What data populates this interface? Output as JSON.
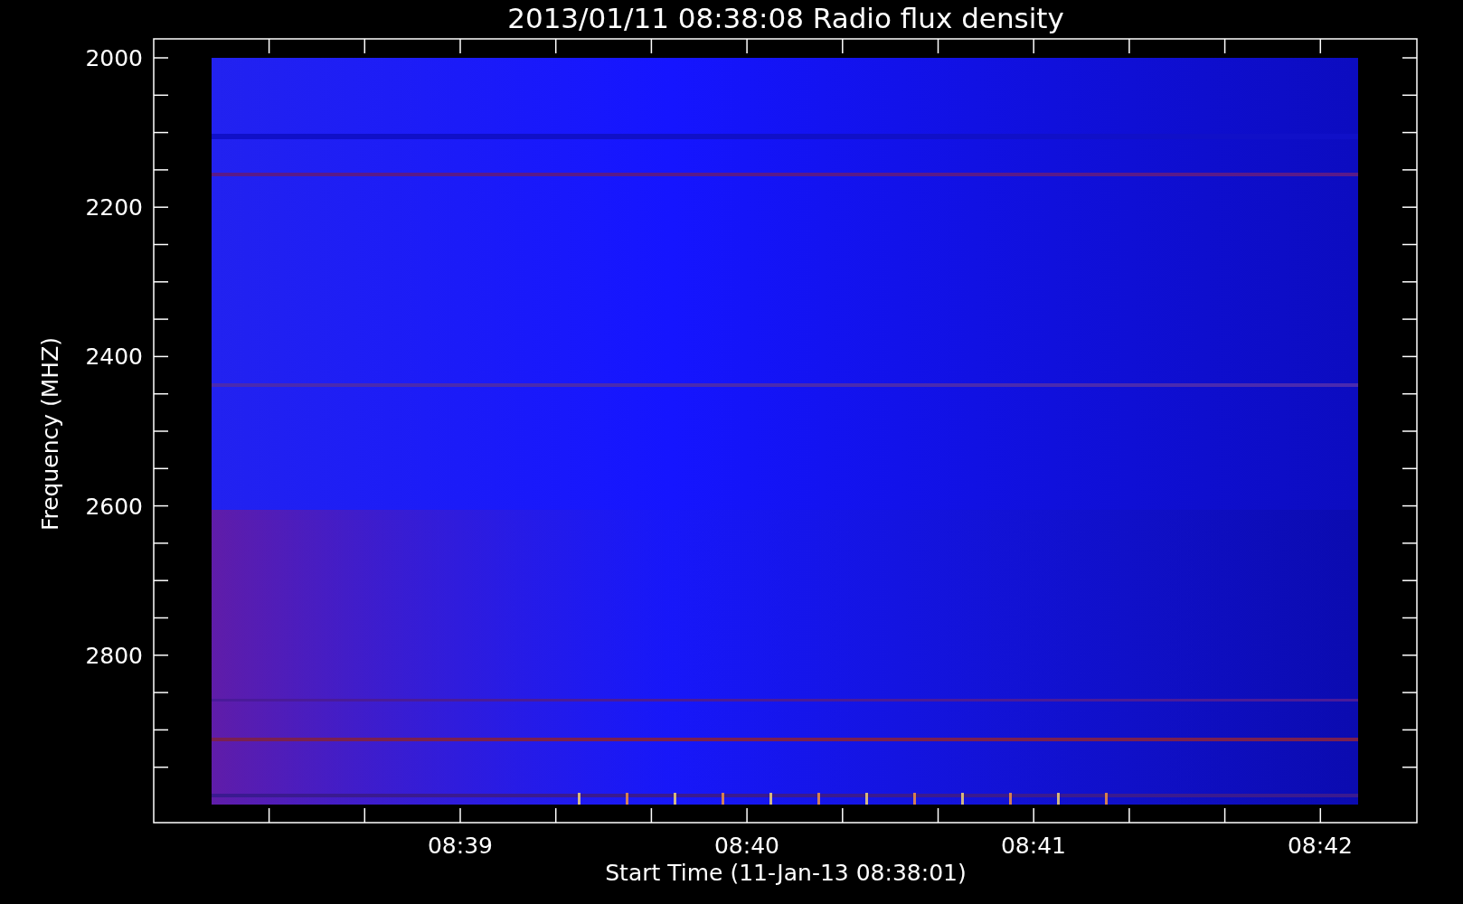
{
  "title": "2013/01/11 08:38:08 Radio flux density",
  "y_axis": {
    "title": "Frequency (MHZ)",
    "ticks": [
      "2000",
      "2200",
      "2400",
      "2600",
      "2800"
    ]
  },
  "x_axis": {
    "title": "Start Time (11-Jan-13 08:38:01)",
    "ticks": [
      "08:39",
      "08:40",
      "08:41",
      "08:42"
    ]
  }
}
